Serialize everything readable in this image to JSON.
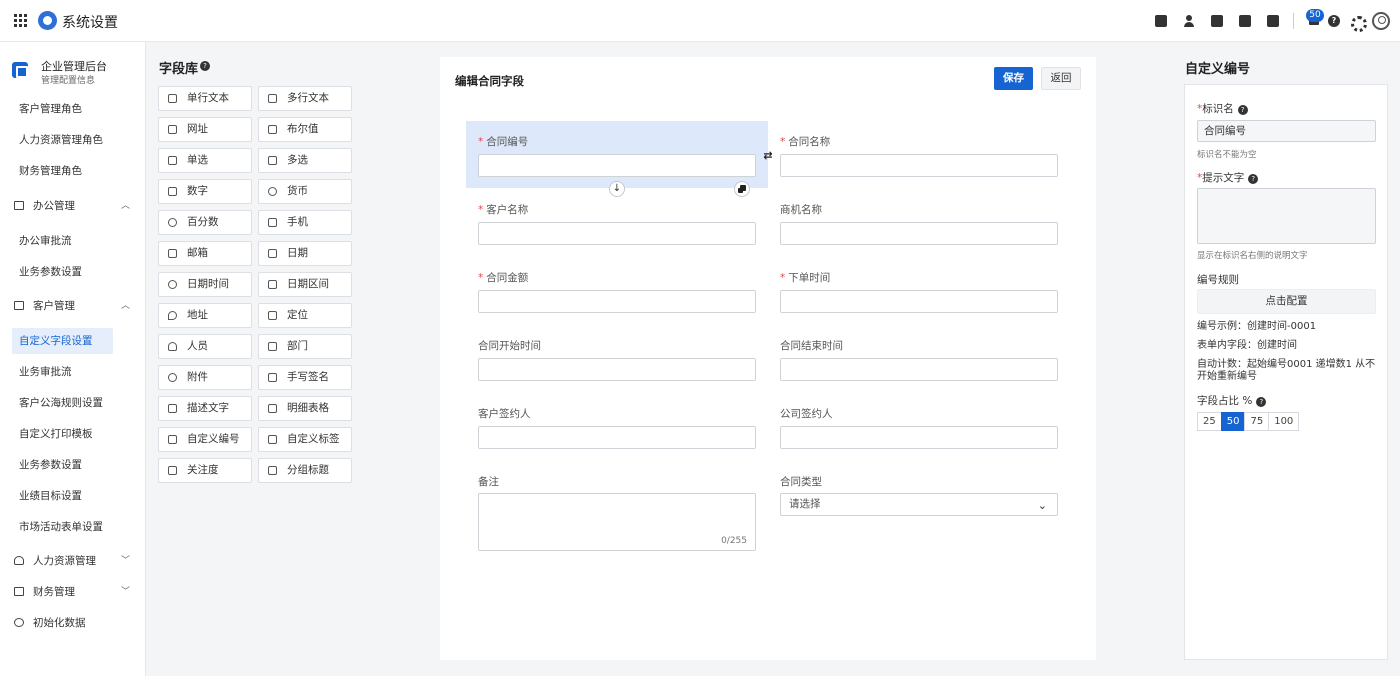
{
  "topbar": {
    "title": "系统设置",
    "notification_count": "50"
  },
  "sidebar": {
    "header_title": "企业管理后台",
    "header_subtitle": "管理配置信息",
    "items": [
      {
        "label": "客户管理角色"
      },
      {
        "label": "人力资源管理角色"
      },
      {
        "label": "财务管理角色"
      }
    ],
    "groups": [
      {
        "label": "办公管理",
        "expanded": true,
        "icon": "briefcase-icon",
        "items": [
          {
            "label": "办公审批流"
          },
          {
            "label": "业务参数设置"
          }
        ]
      },
      {
        "label": "客户管理",
        "expanded": true,
        "icon": "building-icon",
        "items": [
          {
            "label": "自定义字段设置",
            "active": true
          },
          {
            "label": "业务审批流"
          },
          {
            "label": "客户公海规则设置"
          },
          {
            "label": "自定义打印模板"
          },
          {
            "label": "业务参数设置"
          },
          {
            "label": "业绩目标设置"
          },
          {
            "label": "市场活动表单设置"
          }
        ]
      },
      {
        "label": "人力资源管理",
        "expanded": false,
        "icon": "person-icon"
      },
      {
        "label": "财务管理",
        "expanded": false,
        "icon": "finance-icon"
      },
      {
        "label": "初始化数据",
        "expanded": false,
        "icon": "recycle-icon"
      }
    ]
  },
  "field_library": {
    "title": "字段库",
    "items": [
      {
        "label": "单行文本",
        "icon": "text-icon"
      },
      {
        "label": "多行文本",
        "icon": "multiline-text-icon"
      },
      {
        "label": "网址",
        "icon": "link-icon"
      },
      {
        "label": "布尔值",
        "icon": "boolean-icon"
      },
      {
        "label": "单选",
        "icon": "radio-icon"
      },
      {
        "label": "多选",
        "icon": "checkbox-icon"
      },
      {
        "label": "数字",
        "icon": "number-icon"
      },
      {
        "label": "货币",
        "icon": "currency-icon"
      },
      {
        "label": "百分数",
        "icon": "percent-icon"
      },
      {
        "label": "手机",
        "icon": "phone-icon"
      },
      {
        "label": "邮箱",
        "icon": "mail-icon"
      },
      {
        "label": "日期",
        "icon": "date-icon"
      },
      {
        "label": "日期时间",
        "icon": "clock-icon"
      },
      {
        "label": "日期区间",
        "icon": "date-range-icon"
      },
      {
        "label": "地址",
        "icon": "location-pin-icon"
      },
      {
        "label": "定位",
        "icon": "navigate-icon"
      },
      {
        "label": "人员",
        "icon": "user-icon"
      },
      {
        "label": "部门",
        "icon": "department-icon"
      },
      {
        "label": "附件",
        "icon": "attachment-icon"
      },
      {
        "label": "手写签名",
        "icon": "pen-icon"
      },
      {
        "label": "描述文字",
        "icon": "paragraph-icon"
      },
      {
        "label": "明细表格",
        "icon": "table-icon"
      },
      {
        "label": "自定义编号",
        "icon": "list-icon"
      },
      {
        "label": "自定义标签",
        "icon": "tag-icon"
      },
      {
        "label": "关注度",
        "icon": "star-icon"
      },
      {
        "label": "分组标题",
        "icon": "layers-icon"
      }
    ]
  },
  "form": {
    "title": "编辑合同字段",
    "save_label": "保存",
    "back_label": "返回",
    "fields": [
      {
        "label": "合同编号",
        "required": true,
        "type": "input",
        "selected": true
      },
      {
        "label": "合同名称",
        "required": true,
        "type": "input"
      },
      {
        "label": "客户名称",
        "required": true,
        "type": "input"
      },
      {
        "label": "商机名称",
        "required": false,
        "type": "input"
      },
      {
        "label": "合同金额",
        "required": true,
        "type": "input"
      },
      {
        "label": "下单时间",
        "required": true,
        "type": "input"
      },
      {
        "label": "合同开始时间",
        "required": false,
        "type": "input"
      },
      {
        "label": "合同结束时间",
        "required": false,
        "type": "input"
      },
      {
        "label": "客户签约人",
        "required": false,
        "type": "input"
      },
      {
        "label": "公司签约人",
        "required": false,
        "type": "input"
      },
      {
        "label": "备注",
        "required": false,
        "type": "textarea",
        "counter": "0/255"
      },
      {
        "label": "合同类型",
        "required": false,
        "type": "select",
        "placeholder": "请选择"
      }
    ]
  },
  "props": {
    "title": "自定义编号",
    "name_label": "标识名",
    "name_value": "合同编号",
    "name_hint": "标识名不能为空",
    "tip_label": "提示文字",
    "tip_hint": "显示在标识名右侧的说明文字",
    "rule_label": "编号规则",
    "config_button": "点击配置",
    "example": "编号示例：创建时间-0001",
    "form_field": "表单内字段：创建时间",
    "auto_count": "自动计数：起始编号0001 递增数1 从不开始重新编号",
    "ratio_label": "字段占比 %",
    "ratio_options": [
      "25",
      "50",
      "75",
      "100"
    ],
    "ratio_selected": "50"
  },
  "colors": {
    "primary": "#1664d1",
    "required": "#e5484d",
    "selected_bg": "#dde9fb"
  }
}
